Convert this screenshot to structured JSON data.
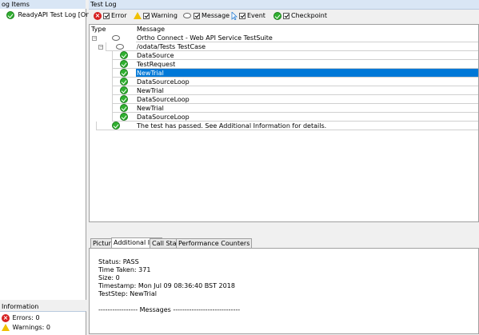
{
  "left": {
    "title": "og Items",
    "tree_items": [
      {
        "label": "ReadyAPI Test Log [Ortho..."
      }
    ],
    "info": {
      "title": "Information",
      "errors": "Errors: 0",
      "warnings": "Warnings: 0"
    }
  },
  "right": {
    "title": "Test Log",
    "filters": [
      {
        "label": "Error",
        "icon": "error-icon",
        "checked": true
      },
      {
        "label": "Warning",
        "icon": "warning-icon",
        "checked": true
      },
      {
        "label": "Message",
        "icon": "message-icon",
        "checked": true
      },
      {
        "label": "Event",
        "icon": "event-icon",
        "checked": true
      },
      {
        "label": "Checkpoint",
        "icon": "checkpoint-icon",
        "checked": true
      }
    ],
    "columns": {
      "type": "Type",
      "message": "Message"
    },
    "rows": [
      {
        "message": "Ortho Connect - Web API Service TestSuite",
        "icon": "message-icon",
        "level": 0,
        "expander": "−"
      },
      {
        "message": "/odata/Tests TestCase",
        "icon": "message-icon",
        "level": 1,
        "expander": "−"
      },
      {
        "message": "DataSource",
        "icon": "checkpoint-icon",
        "level": 2
      },
      {
        "message": "TestRequest",
        "icon": "checkpoint-icon",
        "level": 2
      },
      {
        "message": "NewTrial",
        "icon": "checkpoint-icon",
        "level": 2,
        "selected": true
      },
      {
        "message": "DataSourceLoop",
        "icon": "checkpoint-icon",
        "level": 2
      },
      {
        "message": "NewTrial",
        "icon": "checkpoint-icon",
        "level": 2
      },
      {
        "message": "DataSourceLoop",
        "icon": "checkpoint-icon",
        "level": 2
      },
      {
        "message": "NewTrial",
        "icon": "checkpoint-icon",
        "level": 2
      },
      {
        "message": "DataSourceLoop",
        "icon": "checkpoint-icon",
        "level": 2
      },
      {
        "message": "The test has passed. See Additional Information for details.",
        "icon": "checkpoint-icon",
        "level": 0
      }
    ],
    "tabs": [
      {
        "label": "Picture",
        "active": false
      },
      {
        "label": "Additional Info",
        "active": true
      },
      {
        "label": "Call Stack",
        "active": false
      },
      {
        "label": "Performance Counters",
        "active": false
      }
    ],
    "additional_info": [
      "Status: PASS",
      "Time Taken: 371",
      "Size: 0",
      "Timestamp: Mon Jul 09 08:36:40 BST 2018",
      "TestStep: NewTrial",
      "",
      "----------------- Messages -----------------------------"
    ]
  },
  "colors": {
    "selection": "#0078d7",
    "title_bar": "#d9e6f5",
    "pass": "#2fb02f",
    "error": "#d62020",
    "warning": "#f0c000"
  }
}
